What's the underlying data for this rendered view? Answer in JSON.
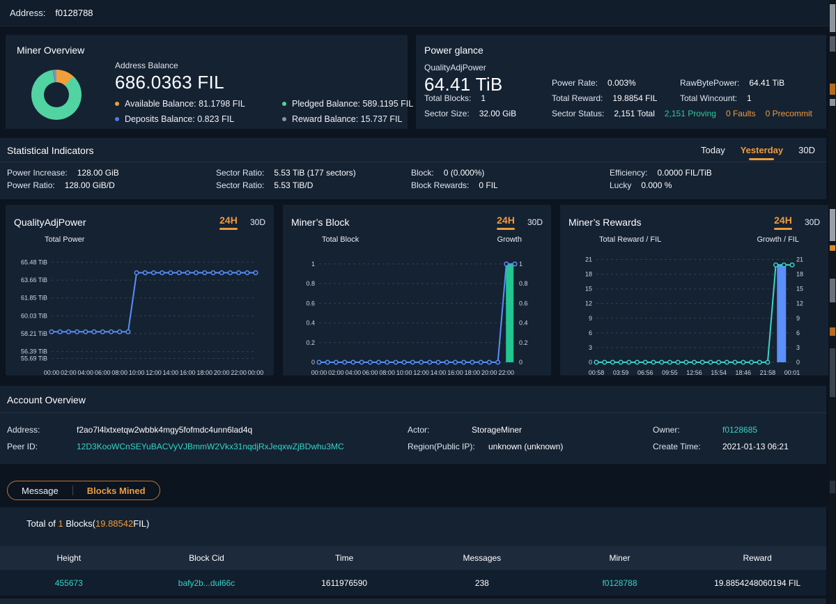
{
  "colors": {
    "accent": "#ef9b3d",
    "link": "#36d5c6",
    "green": "#31c79a",
    "blue": "#5b8ff9"
  },
  "topbar": {
    "address_label": "Address:",
    "address_value": "f0128788"
  },
  "miner_overview": {
    "title": "Miner Overview",
    "balance_label": "Address Balance",
    "balance_value": "686.0363 FIL",
    "legend": [
      {
        "label": "Available Balance: 81.1798 FIL",
        "color": "#efa03b",
        "value": 81.1798
      },
      {
        "label": "Deposits Balance: 0.823 FIL",
        "color": "#4d7ce8",
        "value": 0.823
      },
      {
        "label": "Pledged Balance: 589.1195 FIL",
        "color": "#52d3a2",
        "value": 589.1195
      },
      {
        "label": "Reward Balance: 15.737 FIL",
        "color": "#8a94a6",
        "value": 15.737
      }
    ],
    "donut_clockwise_order": [
      0,
      2,
      1,
      3
    ]
  },
  "power_glance": {
    "title": "Power glance",
    "qap_label": "QualityAdjPower",
    "qap_value": "64.41 TiB",
    "rows_left": [
      {
        "label": "Total Blocks:",
        "value": "1"
      },
      {
        "label": "Sector Size:",
        "value": "32.00 GiB"
      }
    ],
    "rows_mid": [
      {
        "label": "Power Rate:",
        "value": "0.003%"
      },
      {
        "label": "Total Reward:",
        "value": "19.8854 FIL"
      }
    ],
    "sector_status": {
      "label": "Sector Status:",
      "total": "2,151 Total",
      "proving": "2,151 Proving",
      "faults": "0 Faults",
      "precommit": "0 Precommit"
    },
    "rows_right": [
      {
        "label": "RawBytePower:",
        "value": "64.41 TiB"
      },
      {
        "label": "Total Wincount:",
        "value": "1"
      }
    ]
  },
  "stats": {
    "title": "Statistical Indicators",
    "tabs": [
      "Today",
      "Yesterday",
      "30D"
    ],
    "active_tab": "Yesterday",
    "items": [
      {
        "label": "Power Increase:",
        "value": "128.00 GiB"
      },
      {
        "label": "Power Ratio:",
        "value": "128.00 GiB/D"
      },
      {
        "label": "Sector Ratio:",
        "value": "5.53 TiB (177 sectors)"
      },
      {
        "label": "Sector Ratio:",
        "value": "5.53 TiB/D"
      },
      {
        "label": "Block:",
        "value": "0 (0.000%)"
      },
      {
        "label": "Block Rewards:",
        "value": "0 FIL"
      },
      {
        "label": "Efficiency:",
        "value": "0.0000 FIL/TiB"
      },
      {
        "label": "Lucky",
        "value": "0.000 %"
      }
    ]
  },
  "chart_data": [
    {
      "type": "line",
      "title": "QualityAdjPower",
      "tabs": [
        "24H",
        "30D"
      ],
      "active_tab": "24H",
      "left_axis_label": "Total Power",
      "right_axis_label": "",
      "ylim": [
        55.3,
        66.5
      ],
      "y_ticks": [
        {
          "label": "65.48 TiB",
          "value": 65.48
        },
        {
          "label": "63.66 TiB",
          "value": 63.66
        },
        {
          "label": "61.85 TiB",
          "value": 61.85
        },
        {
          "label": "60.03 TiB",
          "value": 60.03
        },
        {
          "label": "58.21 TiB",
          "value": 58.21
        },
        {
          "label": "56.39 TiB",
          "value": 56.39
        },
        {
          "label": "55.69 TiB",
          "value": 55.69
        }
      ],
      "x_ticks": [
        {
          "index": 0,
          "label": "00:00"
        },
        {
          "index": 2,
          "label": "02:00"
        },
        {
          "index": 4,
          "label": "04:00"
        },
        {
          "index": 6,
          "label": "06:00"
        },
        {
          "index": 8,
          "label": "08:00"
        },
        {
          "index": 10,
          "label": "10:00"
        },
        {
          "index": 12,
          "label": "12:00"
        },
        {
          "index": 14,
          "label": "14:00"
        },
        {
          "index": 16,
          "label": "16:00"
        },
        {
          "index": 18,
          "label": "18:00"
        },
        {
          "index": 20,
          "label": "20:00"
        },
        {
          "index": 22,
          "label": "22:00"
        },
        {
          "index": 24,
          "label": "00:00"
        }
      ],
      "series": [
        {
          "name": "Total Power",
          "type": "line",
          "color": "#5b8ff9",
          "values": [
            58.4,
            58.4,
            58.4,
            58.4,
            58.4,
            58.4,
            58.4,
            58.4,
            58.4,
            58.4,
            64.41,
            64.41,
            64.41,
            64.41,
            64.41,
            64.41,
            64.41,
            64.41,
            64.41,
            64.41,
            64.41,
            64.41,
            64.41,
            64.41,
            64.41
          ]
        }
      ]
    },
    {
      "type": "line+bar",
      "title": "Miner’s Block",
      "tabs": [
        "24H",
        "30D"
      ],
      "active_tab": "24H",
      "left_axis_label": "Total Block",
      "right_axis_label": "Growth",
      "ylim": [
        0,
        1.12
      ],
      "y_ticks": [
        {
          "label": "1",
          "value": 1
        },
        {
          "label": "0.8",
          "value": 0.8
        },
        {
          "label": "0.6",
          "value": 0.6
        },
        {
          "label": "0.4",
          "value": 0.4
        },
        {
          "label": "0.2",
          "value": 0.2
        },
        {
          "label": "0",
          "value": 0
        }
      ],
      "x_ticks": [
        {
          "index": 0,
          "label": "00:00"
        },
        {
          "index": 2,
          "label": "02:00"
        },
        {
          "index": 4,
          "label": "04:00"
        },
        {
          "index": 6,
          "label": "06:00"
        },
        {
          "index": 8,
          "label": "08:00"
        },
        {
          "index": 10,
          "label": "10:00"
        },
        {
          "index": 12,
          "label": "12:00"
        },
        {
          "index": 14,
          "label": "14:00"
        },
        {
          "index": 16,
          "label": "16:00"
        },
        {
          "index": 18,
          "label": "18:00"
        },
        {
          "index": 20,
          "label": "20:00"
        },
        {
          "index": 22,
          "label": "22:00"
        }
      ],
      "series": [
        {
          "name": "Growth",
          "type": "bar",
          "color": "#21c690",
          "index": 22.4,
          "width": 11,
          "value": 1
        },
        {
          "name": "Total Block",
          "type": "line",
          "color": "#5b8ff9",
          "values": [
            0,
            0,
            0,
            0,
            0,
            0,
            0,
            0,
            0,
            0,
            0,
            0,
            0,
            0,
            0,
            0,
            0,
            0,
            0,
            0,
            0,
            0,
            1,
            1
          ]
        }
      ]
    },
    {
      "type": "line+bar",
      "title": "Miner’s Rewards",
      "tabs": [
        "24H",
        "30D"
      ],
      "active_tab": "24H",
      "left_axis_label": "Total Reward / FIL",
      "right_axis_label": "Growth / FIL",
      "ylim": [
        0,
        22.5
      ],
      "y_ticks": [
        {
          "label": "21",
          "value": 21
        },
        {
          "label": "18",
          "value": 18
        },
        {
          "label": "15",
          "value": 15
        },
        {
          "label": "12",
          "value": 12
        },
        {
          "label": "9",
          "value": 9
        },
        {
          "label": "6",
          "value": 6
        },
        {
          "label": "3",
          "value": 3
        },
        {
          "label": "0",
          "value": 0
        }
      ],
      "x_ticks": [
        {
          "index": 0,
          "label": "00:58"
        },
        {
          "index": 3,
          "label": "03:59"
        },
        {
          "index": 6,
          "label": "06:56"
        },
        {
          "index": 9,
          "label": "09:55"
        },
        {
          "index": 12,
          "label": "12:56"
        },
        {
          "index": 15,
          "label": "15:54"
        },
        {
          "index": 18,
          "label": "18:46"
        },
        {
          "index": 21,
          "label": "21:58"
        },
        {
          "index": 24,
          "label": "00:01"
        }
      ],
      "series": [
        {
          "name": "Growth / FIL",
          "type": "bar",
          "color": "#5b8ff9",
          "index": 22.7,
          "width": 13,
          "value": 19.89
        },
        {
          "name": "Total Reward / FIL",
          "type": "line",
          "color": "#3ad5c9",
          "values": [
            0,
            0,
            0,
            0,
            0,
            0,
            0,
            0,
            0,
            0,
            0,
            0,
            0,
            0,
            0,
            0,
            0,
            0,
            0,
            0,
            0,
            0,
            19.9,
            19.9,
            19.9
          ]
        }
      ]
    }
  ],
  "account": {
    "title": "Account Overview",
    "address_label": "Address:",
    "address_value": "f2ao7l4lxtxetqw2wbbk4mgy5fofmdc4unn6lad4q",
    "peer_label": "Peer ID:",
    "peer_value": "12D3KooWCnSEYuBACVyVJBmmW2Vkx31nqdjRxJeqxwZjBDwhu3MC",
    "actor_label": "Actor:",
    "actor_value": "StorageMiner",
    "region_label": "Region(Public IP):",
    "region_value": "unknown (unknown)",
    "owner_label": "Owner:",
    "owner_value": "f0128685",
    "create_label": "Create Time:",
    "create_value": "2021-01-13 06:21"
  },
  "blocks_section": {
    "tabs": [
      "Message",
      "Blocks Mined"
    ],
    "active_tab": "Blocks Mined",
    "summary_prefix": "Total of ",
    "summary_count": "1",
    "summary_mid": " Blocks(",
    "summary_amount": "19.88542",
    "summary_suffix": "FIL)"
  },
  "table": {
    "headers": [
      "Height",
      "Block Cid",
      "Time",
      "Messages",
      "Miner",
      "Reward"
    ],
    "rows": [
      [
        "455673",
        "bafy2b...dul66c",
        "1611976590",
        "238",
        "f0128788",
        "19.8854248060194 FIL"
      ]
    ],
    "link_columns": [
      0,
      1,
      4
    ]
  }
}
